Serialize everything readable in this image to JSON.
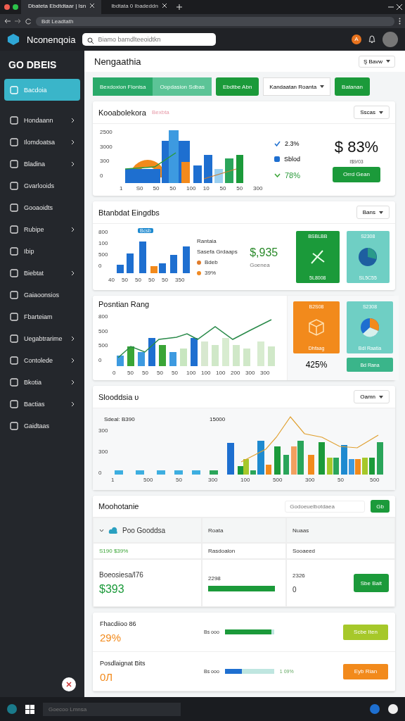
{
  "browser": {
    "tabs": [
      {
        "title": "Dbateta Ebdtdtaar | Isn",
        "selected": true
      },
      {
        "title": "Ibdtata 0 Ibadeddn",
        "selected": false
      }
    ],
    "address": "Bdt Leadtath"
  },
  "app": {
    "brand": "Nconenqoia",
    "search_placeholder": "Biamo bamdlteeoidtkn",
    "badge": "A"
  },
  "sidebar": {
    "heading": "GO DBEIS",
    "items": [
      {
        "label": "Bacdoia",
        "selected": true,
        "expandable": false
      },
      {
        "label": "Hondaann",
        "selected": false,
        "expandable": true
      },
      {
        "label": "Ilomdoatsa",
        "selected": false,
        "expandable": true
      },
      {
        "label": "Bladina",
        "selected": false,
        "expandable": true
      },
      {
        "label": "Gvarlooids",
        "selected": false,
        "expandable": false
      },
      {
        "label": "Gooaoidts",
        "selected": false,
        "expandable": false
      },
      {
        "label": "Rubipe",
        "selected": false,
        "expandable": true
      },
      {
        "label": "Ibip",
        "selected": false,
        "expandable": false
      },
      {
        "label": "Biebtat",
        "selected": false,
        "expandable": true
      },
      {
        "label": "Gaiaoonsios",
        "selected": false,
        "expandable": false
      },
      {
        "label": "Fbarteiam",
        "selected": false,
        "expandable": false
      },
      {
        "label": "Uegabtrarime",
        "selected": false,
        "expandable": true
      },
      {
        "label": "Contolede",
        "selected": false,
        "expandable": true
      },
      {
        "label": "Bkotia",
        "selected": false,
        "expandable": true
      },
      {
        "label": "Bactias",
        "selected": false,
        "expandable": true
      },
      {
        "label": "Gaidtaas",
        "selected": false,
        "expandable": false
      }
    ]
  },
  "page": {
    "title": "Nengaathia",
    "view_menu": "Ş Bavw"
  },
  "toolbar": {
    "segments": [
      {
        "label": "Bexdoxion Flonisa",
        "selected": true
      },
      {
        "label": "Oopdasion Sdbas",
        "selected": false
      }
    ],
    "action": "Ebdtbe Abn",
    "dropdown": "Kandaatan Roanta",
    "primary": "Batanan"
  },
  "overview": {
    "title": "Kooabolekora",
    "subtitle": "Bexbta",
    "dropdown": "Sscas",
    "y_labels": [
      "2500",
      "3000",
      "300",
      "0"
    ],
    "x_labels": [
      "1",
      "S0",
      "50",
      "50",
      "100",
      "10",
      "50",
      "50",
      "300"
    ],
    "stats": [
      {
        "value": "2.3%",
        "kind": "check"
      },
      {
        "value": "Sblod",
        "kind": "square"
      },
      {
        "value": "78%",
        "kind": "trend"
      }
    ],
    "big_value": "$ 83%",
    "caption": "I$9/03",
    "button": "Orrd Gean"
  },
  "breakdown": {
    "title": "Btanbdat Eingdbs",
    "dropdown": "Bans",
    "tag": "Bcsb",
    "y_labels": [
      "800",
      "100",
      "500",
      "0"
    ],
    "x_labels": [
      "40",
      "50",
      "50",
      "50",
      "50",
      "350"
    ],
    "legend_title": "Rantaia",
    "legend_subtitle": "Sasefa Grdaaps",
    "legend": [
      {
        "label": "Bdeb",
        "color": "#e07b2a"
      },
      {
        "label": "39%",
        "color": "#f08a24"
      }
    ],
    "big_value": "$,935",
    "note": "Goenea",
    "tiles": [
      {
        "top": "BSBLBB",
        "bottom": "5L8008",
        "kind": "green"
      },
      {
        "top": "S2308",
        "bottom": "SL5C55",
        "kind": "teal"
      }
    ]
  },
  "position": {
    "title": "Posntian Rang",
    "y_labels": [
      "800",
      "500",
      "500",
      "0"
    ],
    "x_labels": [
      "0",
      "50",
      "50",
      "50",
      "50",
      "100",
      "100",
      "100",
      "200",
      "300",
      "300"
    ],
    "tiles": [
      {
        "top": "B2S08",
        "bottom": "Dhfaag",
        "kind": "orange"
      },
      {
        "top": "S2308",
        "bottom": "Bdl Raatia",
        "kind": "teal"
      }
    ],
    "percent": "425%",
    "button": "Bd Rana"
  },
  "summary": {
    "title": "Slooddsia υ",
    "dropdown": "Oamn",
    "left_label": "Sdeal: B390",
    "right_label": "15000",
    "y_labels": [
      "300",
      "300",
      "0"
    ],
    "x_labels": [
      "1",
      "500",
      "50",
      "300",
      "100",
      "500",
      "300",
      "50",
      "500"
    ]
  },
  "table": {
    "title": "Moohotanie",
    "search_placeholder": "Godoeuelbotdaea",
    "search_button": "Gb",
    "group": "Poo Gooddsa",
    "group_value": "S190 $39%",
    "columns": [
      "Roata",
      "Nuaas"
    ],
    "row_labels": [
      "Rasdoalon",
      "Sooaeed"
    ],
    "item": {
      "name": "Boeosiesa/l76",
      "amount": "$393",
      "col_1": "2298",
      "col_2": "2326",
      "col_2_sub": "0",
      "level": 1,
      "button": "Sbe Bait"
    }
  },
  "tasks": [
    {
      "name": "Fhacdiioo 86",
      "value": "29%",
      "bar_label": "Bs ooo",
      "level": 0.95,
      "button": "Scbe Iten",
      "color": "#a6c82a"
    },
    {
      "name": "Posdlaignat Bits",
      "value": "0Л",
      "bar_label": "Bs ooo",
      "level": 0.35,
      "button": "Eyb Rian",
      "color": "#f28a1c",
      "tail": "1 09%"
    }
  ],
  "taskbar": {
    "search_placeholder": "Goecoo Lmnsa"
  }
}
